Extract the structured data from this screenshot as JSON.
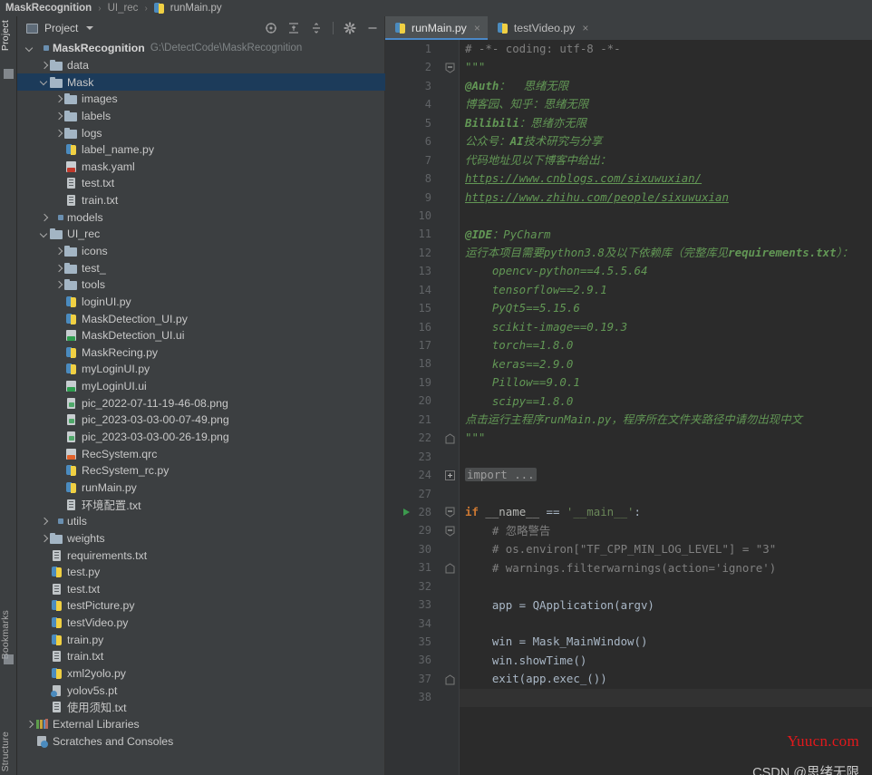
{
  "breadcrumb": {
    "root": "MaskRecognition",
    "folder": "UI_rec",
    "file": "runMain.py",
    "separator": "›"
  },
  "toolstrip": {
    "project_label": "Project",
    "bookmarks_label": "Bookmarks",
    "structure_label": "Structure"
  },
  "project_panel": {
    "title": "Project",
    "actions": [
      {
        "name": "select-opened-file",
        "tooltip": "Select Opened File"
      },
      {
        "name": "expand-all",
        "tooltip": "Expand All"
      },
      {
        "name": "collapse-all",
        "tooltip": "Collapse All"
      },
      {
        "name": "settings",
        "tooltip": "Options"
      },
      {
        "name": "hide",
        "tooltip": "Hide"
      }
    ],
    "tree": [
      {
        "indent": 0,
        "arrow": "down",
        "icon": "folder-mod",
        "label": "MaskRecognition",
        "bold": true,
        "path": "G:\\DetectCode\\MaskRecognition",
        "selected": false
      },
      {
        "indent": 1,
        "arrow": "right",
        "icon": "folder",
        "label": "data",
        "selected": false
      },
      {
        "indent": 1,
        "arrow": "down",
        "icon": "folder",
        "label": "Mask",
        "selected": true
      },
      {
        "indent": 2,
        "arrow": "right",
        "icon": "folder",
        "label": "images",
        "selected": false
      },
      {
        "indent": 2,
        "arrow": "right",
        "icon": "folder",
        "label": "labels",
        "selected": false
      },
      {
        "indent": 2,
        "arrow": "right",
        "icon": "folder",
        "label": "logs",
        "selected": false
      },
      {
        "indent": 2,
        "arrow": "none",
        "icon": "py",
        "label": "label_name.py",
        "selected": false
      },
      {
        "indent": 2,
        "arrow": "none",
        "icon": "yaml",
        "label": "mask.yaml",
        "selected": false
      },
      {
        "indent": 2,
        "arrow": "none",
        "icon": "txt",
        "label": "test.txt",
        "selected": false
      },
      {
        "indent": 2,
        "arrow": "none",
        "icon": "txt",
        "label": "train.txt",
        "selected": false
      },
      {
        "indent": 1,
        "arrow": "right",
        "icon": "folder-mod",
        "label": "models",
        "selected": false
      },
      {
        "indent": 1,
        "arrow": "down",
        "icon": "folder",
        "label": "UI_rec",
        "selected": false
      },
      {
        "indent": 2,
        "arrow": "right",
        "icon": "folder",
        "label": "icons",
        "selected": false
      },
      {
        "indent": 2,
        "arrow": "right",
        "icon": "folder",
        "label": "test_",
        "selected": false
      },
      {
        "indent": 2,
        "arrow": "right",
        "icon": "folder",
        "label": "tools",
        "selected": false
      },
      {
        "indent": 2,
        "arrow": "none",
        "icon": "py",
        "label": "loginUI.py",
        "selected": false
      },
      {
        "indent": 2,
        "arrow": "none",
        "icon": "py",
        "label": "MaskDetection_UI.py",
        "selected": false
      },
      {
        "indent": 2,
        "arrow": "none",
        "icon": "ui",
        "label": "MaskDetection_UI.ui",
        "selected": false
      },
      {
        "indent": 2,
        "arrow": "none",
        "icon": "py",
        "label": "MaskRecing.py",
        "selected": false
      },
      {
        "indent": 2,
        "arrow": "none",
        "icon": "py",
        "label": "myLoginUI.py",
        "selected": false
      },
      {
        "indent": 2,
        "arrow": "none",
        "icon": "ui",
        "label": "myLoginUI.ui",
        "selected": false
      },
      {
        "indent": 2,
        "arrow": "none",
        "icon": "png",
        "label": "pic_2022-07-11-19-46-08.png",
        "selected": false
      },
      {
        "indent": 2,
        "arrow": "none",
        "icon": "png",
        "label": "pic_2023-03-03-00-07-49.png",
        "selected": false
      },
      {
        "indent": 2,
        "arrow": "none",
        "icon": "png",
        "label": "pic_2023-03-03-00-26-19.png",
        "selected": false
      },
      {
        "indent": 2,
        "arrow": "none",
        "icon": "qrc",
        "label": "RecSystem.qrc",
        "selected": false
      },
      {
        "indent": 2,
        "arrow": "none",
        "icon": "py",
        "label": "RecSystem_rc.py",
        "selected": false
      },
      {
        "indent": 2,
        "arrow": "none",
        "icon": "py",
        "label": "runMain.py",
        "selected": false
      },
      {
        "indent": 2,
        "arrow": "none",
        "icon": "txt",
        "label": "环境配置.txt",
        "selected": false
      },
      {
        "indent": 1,
        "arrow": "right",
        "icon": "folder-mod",
        "label": "utils",
        "selected": false
      },
      {
        "indent": 1,
        "arrow": "right",
        "icon": "folder",
        "label": "weights",
        "selected": false
      },
      {
        "indent": 1,
        "arrow": "none",
        "icon": "txt",
        "label": "requirements.txt",
        "selected": false
      },
      {
        "indent": 1,
        "arrow": "none",
        "icon": "py",
        "label": "test.py",
        "selected": false
      },
      {
        "indent": 1,
        "arrow": "none",
        "icon": "txt",
        "label": "test.txt",
        "selected": false
      },
      {
        "indent": 1,
        "arrow": "none",
        "icon": "py",
        "label": "testPicture.py",
        "selected": false
      },
      {
        "indent": 1,
        "arrow": "none",
        "icon": "py",
        "label": "testVideo.py",
        "selected": false
      },
      {
        "indent": 1,
        "arrow": "none",
        "icon": "py",
        "label": "train.py",
        "selected": false
      },
      {
        "indent": 1,
        "arrow": "none",
        "icon": "txt",
        "label": "train.txt",
        "selected": false
      },
      {
        "indent": 1,
        "arrow": "none",
        "icon": "py",
        "label": "xml2yolo.py",
        "selected": false
      },
      {
        "indent": 1,
        "arrow": "none",
        "icon": "pt",
        "label": "yolov5s.pt",
        "selected": false
      },
      {
        "indent": 1,
        "arrow": "none",
        "icon": "txt",
        "label": "使用须知.txt",
        "selected": false
      },
      {
        "indent": 0,
        "arrow": "right",
        "icon": "lib",
        "label": "External Libraries",
        "selected": false
      },
      {
        "indent": 0,
        "arrow": "none",
        "icon": "scratch",
        "label": "Scratches and Consoles",
        "selected": false
      }
    ]
  },
  "editor": {
    "tabs": [
      {
        "label": "runMain.py",
        "active": true,
        "close": "×"
      },
      {
        "label": "testVideo.py",
        "active": false,
        "close": "×"
      }
    ],
    "lines": [
      {
        "n": 1,
        "html": "<span class=\"cmt\"># -*- coding: utf-8 -*-</span>",
        "fold": "none"
      },
      {
        "n": 2,
        "html": "<span class=\"docstr\">\"\"\"</span>",
        "fold": "open-top"
      },
      {
        "n": 3,
        "html": "<span class=\"docstr-b\">@Auth</span><span class=\"docstr\">：  思绪无限</span>",
        "fold": "none"
      },
      {
        "n": 4,
        "html": "<span class=\"docstr\">博客园、知乎：思绪无限</span>",
        "fold": "none"
      },
      {
        "n": 5,
        "html": "<span class=\"docstr-b\">Bilibili</span><span class=\"docstr\">：思绪亦无限</span>",
        "fold": "none"
      },
      {
        "n": 6,
        "html": "<span class=\"docstr\">公众号：</span><span class=\"docstr-b\">AI</span><span class=\"docstr\">技术研究与分享</span>",
        "fold": "none"
      },
      {
        "n": 7,
        "html": "<span class=\"docstr\">代码地址见以下博客中给出：</span>",
        "fold": "none"
      },
      {
        "n": 8,
        "html": "<span class=\"link\">https://www.cnblogs.com/sixuwuxian/</span>",
        "fold": "none"
      },
      {
        "n": 9,
        "html": "<span class=\"link\">https://www.zhihu.com/people/sixuwuxian</span>",
        "fold": "none"
      },
      {
        "n": 10,
        "html": "",
        "fold": "none"
      },
      {
        "n": 11,
        "html": "<span class=\"docstr-b\">@IDE</span><span class=\"docstr\">：PyCharm</span>",
        "fold": "none"
      },
      {
        "n": 12,
        "html": "<span class=\"docstr\">运行本项目需要python3.8及以下依赖库（完整库见</span><span class=\"docstr-b\">requirements.txt</span><span class=\"docstr\">）：</span>",
        "fold": "none"
      },
      {
        "n": 13,
        "html": "<span class=\"docstr\">    opencv-python==4.5.5.64</span>",
        "fold": "none"
      },
      {
        "n": 14,
        "html": "<span class=\"docstr\">    tensorflow==2.9.1</span>",
        "fold": "none"
      },
      {
        "n": 15,
        "html": "<span class=\"docstr\">    PyQt5==5.15.6</span>",
        "fold": "none"
      },
      {
        "n": 16,
        "html": "<span class=\"docstr\">    scikit-image==0.19.3</span>",
        "fold": "none"
      },
      {
        "n": 17,
        "html": "<span class=\"docstr\">    torch==1.8.0</span>",
        "fold": "none"
      },
      {
        "n": 18,
        "html": "<span class=\"docstr\">    keras==2.9.0</span>",
        "fold": "none"
      },
      {
        "n": 19,
        "html": "<span class=\"docstr\">    Pillow==9.0.1</span>",
        "fold": "none"
      },
      {
        "n": 20,
        "html": "<span class=\"docstr\">    scipy==1.8.0</span>",
        "fold": "none"
      },
      {
        "n": 21,
        "html": "<span class=\"docstr\">点击运行主程序runMain.py，程序所在文件夹路径中请勿出现中文</span>",
        "fold": "none"
      },
      {
        "n": 22,
        "html": "<span class=\"docstr\">\"\"\"</span>",
        "fold": "close-bottom"
      },
      {
        "n": 23,
        "html": "",
        "fold": "none"
      },
      {
        "n": 24,
        "html": "<span class=\"fold-box\">import ...</span>",
        "fold": "collapsed"
      },
      {
        "n": 27,
        "html": "",
        "fold": "none"
      },
      {
        "n": 28,
        "html": "<span class=\"kw\">if</span> <span class=\"dunder\">__name__</span> == <span class=\"str\">'__main__'</span>:",
        "fold": "open-top",
        "run": true
      },
      {
        "n": 29,
        "html": "    <span class=\"cmt\"># 忽略警告</span>",
        "fold": "open-mid"
      },
      {
        "n": 30,
        "html": "    <span class=\"cmt\"># os.environ[\"TF_CPP_MIN_LOG_LEVEL\"] = \"3\"</span>",
        "fold": "none"
      },
      {
        "n": 31,
        "html": "    <span class=\"cmt\"># warnings.filterwarnings(action='ignore')</span>",
        "fold": "close-bottom"
      },
      {
        "n": 32,
        "html": "",
        "fold": "none"
      },
      {
        "n": 33,
        "html": "    app = QApplication(argv)",
        "fold": "none"
      },
      {
        "n": 34,
        "html": "",
        "fold": "none"
      },
      {
        "n": 35,
        "html": "    win = Mask_MainWindow()",
        "fold": "none"
      },
      {
        "n": 36,
        "html": "    win.showTime()",
        "fold": "none"
      },
      {
        "n": 37,
        "html": "    exit(app.exec_())",
        "fold": "close-bottom"
      },
      {
        "n": 38,
        "html": "",
        "fold": "none",
        "current": true
      }
    ]
  },
  "watermarks": {
    "yuucn": "Yuucn.com",
    "csdn": "CSDN @思绪无限"
  },
  "colors": {
    "panel_bg": "#3C3F41",
    "editor_bg": "#2B2B2B",
    "gutter_bg": "#313335",
    "selection": "#1C3B5A",
    "tab_active": "#4E5254",
    "tab_underline": "#4A88C7",
    "comment": "#808080",
    "docstring": "#629755",
    "keyword": "#CC7832",
    "string": "#6A8759",
    "default_text": "#A9B7C6",
    "watermark_red": "#E2191C"
  }
}
